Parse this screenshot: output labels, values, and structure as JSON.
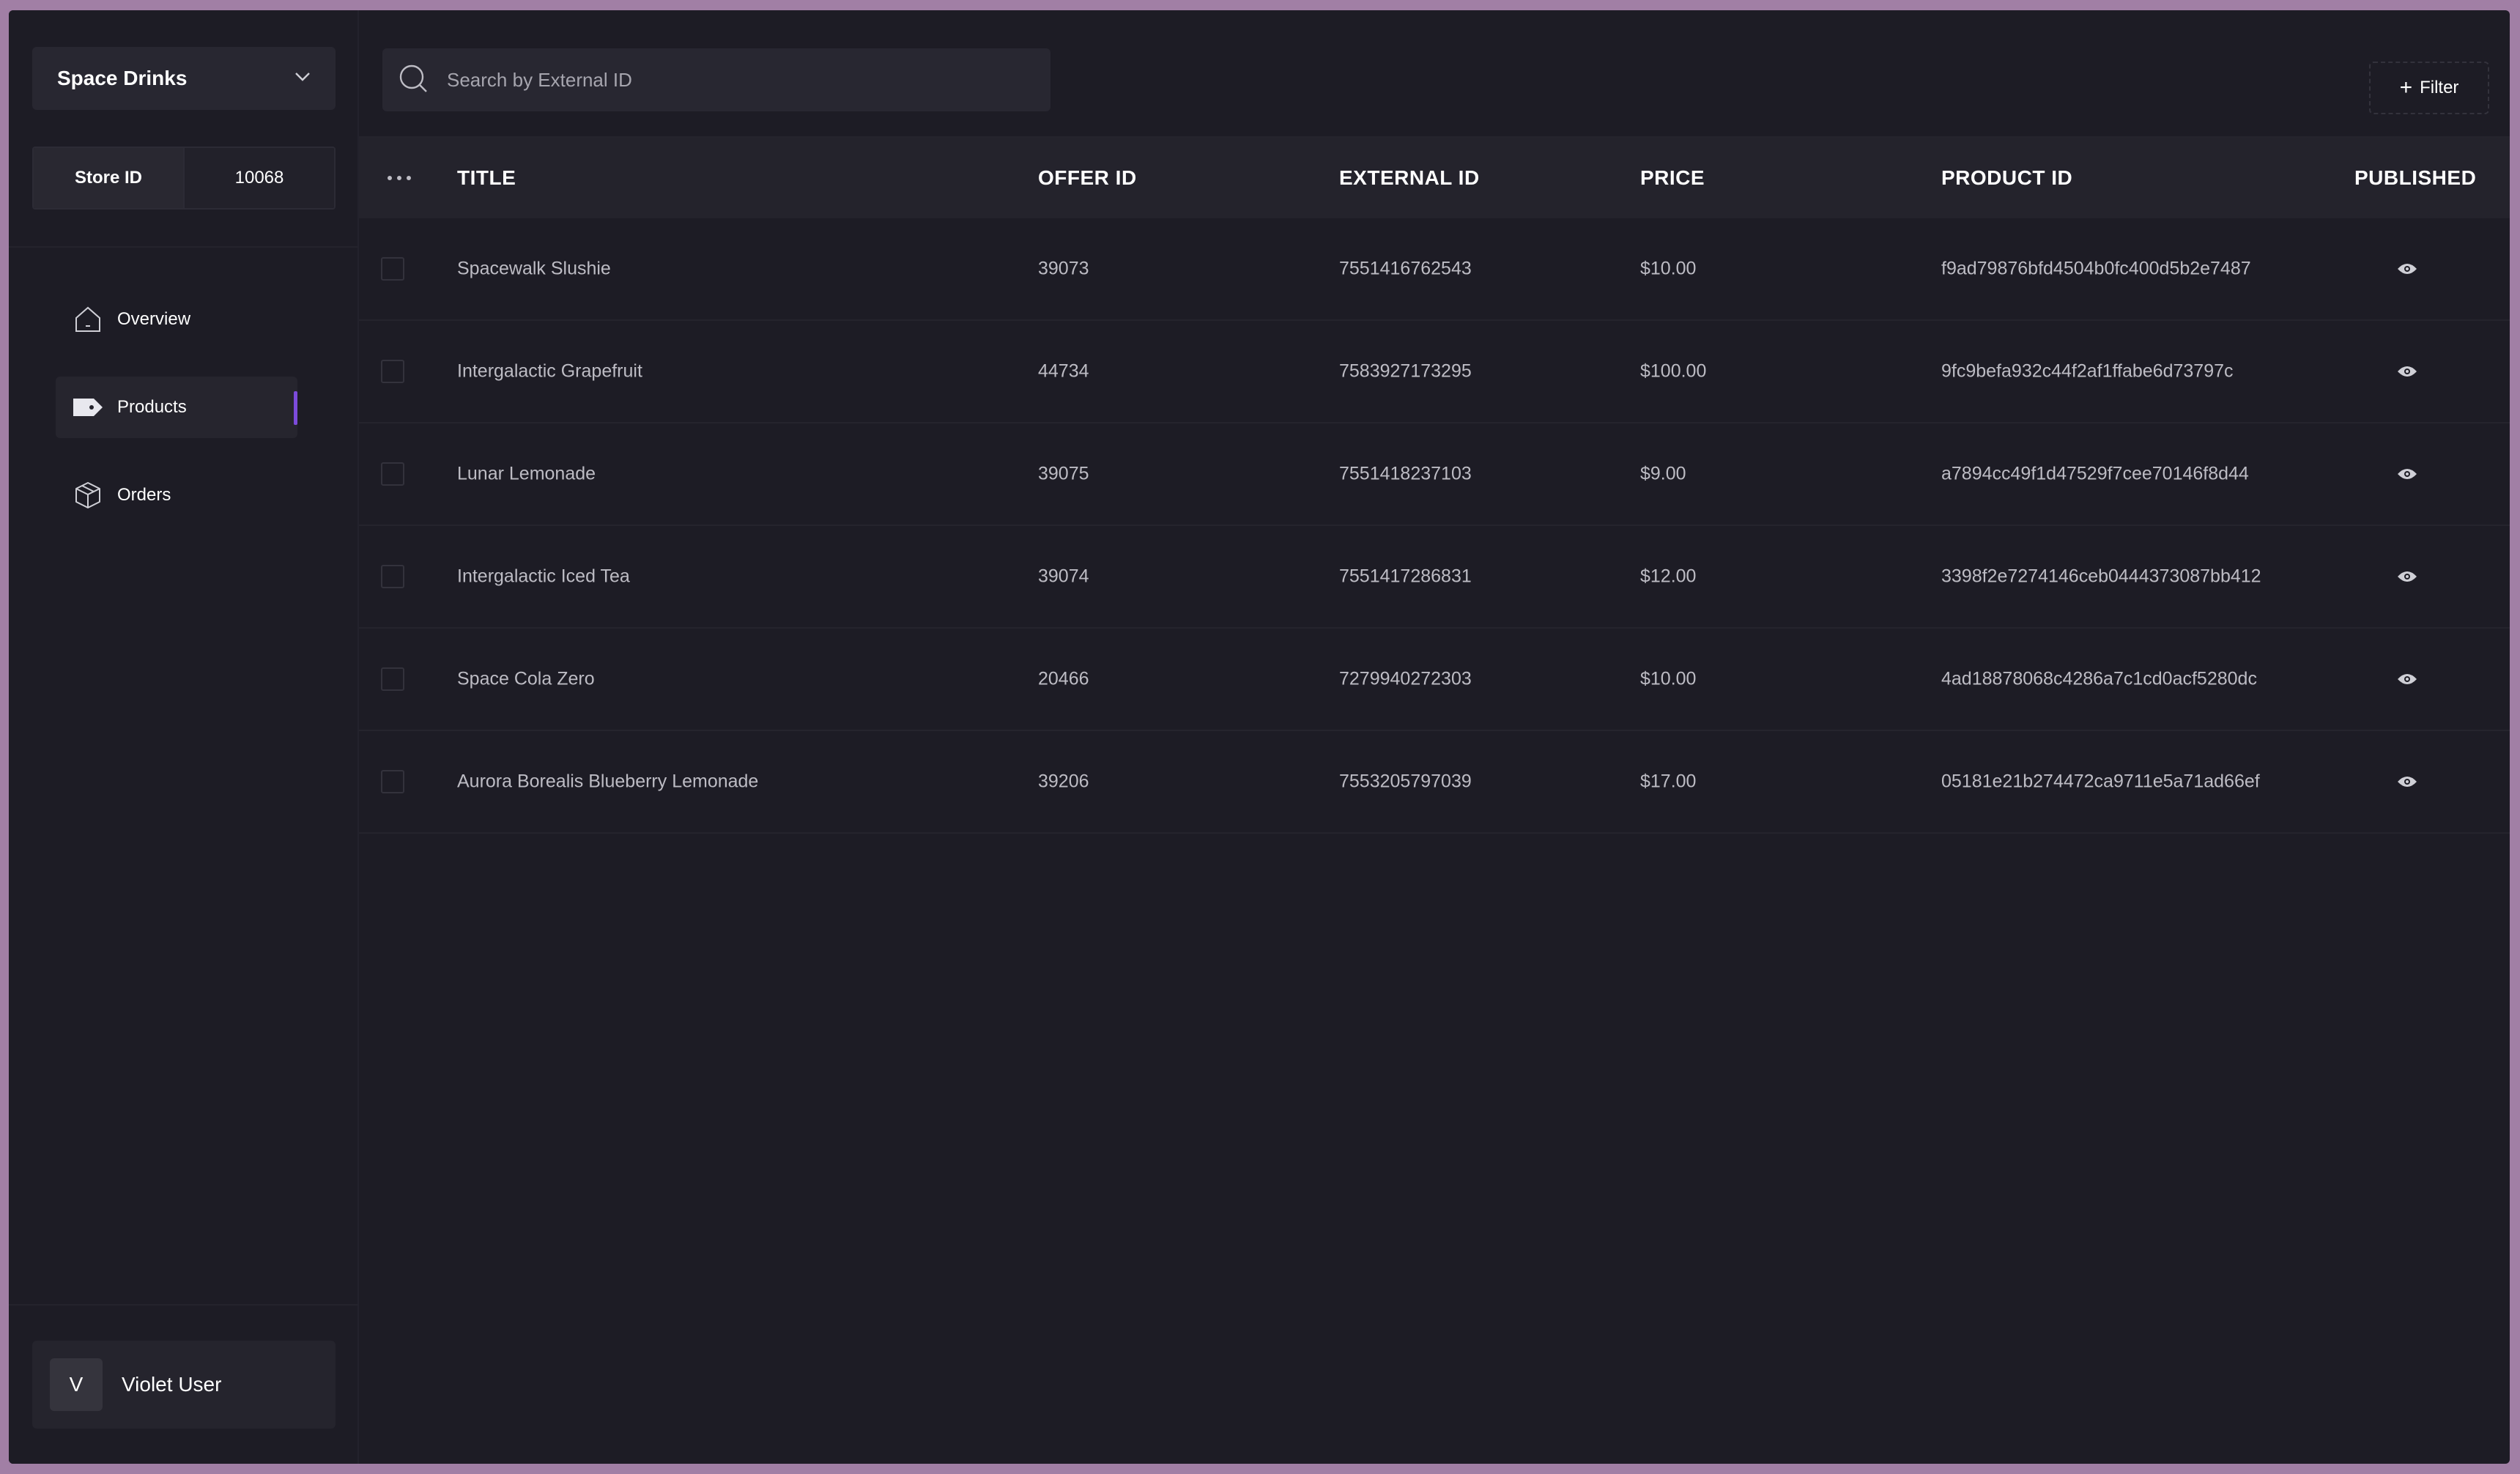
{
  "sidebar": {
    "store_name": "Space Drinks",
    "store_id_label": "Store ID",
    "store_id_value": "10068",
    "nav": [
      {
        "label": "Overview",
        "icon": "home-icon"
      },
      {
        "label": "Products",
        "icon": "tag-icon",
        "active": true
      },
      {
        "label": "Orders",
        "icon": "box-icon"
      }
    ],
    "user": {
      "initial": "V",
      "name": "Violet User"
    }
  },
  "search": {
    "placeholder": "Search by External ID"
  },
  "filter_label": "Filter",
  "table": {
    "headers": {
      "title": "TITLE",
      "offer_id": "OFFER ID",
      "external_id": "EXTERNAL ID",
      "price": "PRICE",
      "product_id": "PRODUCT ID",
      "published": "PUBLISHED"
    },
    "rows": [
      {
        "title": "Spacewalk Slushie",
        "offer_id": "39073",
        "external_id": "7551416762543",
        "price": "$10.00",
        "product_id": "f9ad79876bfd4504b0fc400d5b2e7487"
      },
      {
        "title": "Intergalactic Grapefruit",
        "offer_id": "44734",
        "external_id": "7583927173295",
        "price": "$100.00",
        "product_id": "9fc9befa932c44f2af1ffabe6d73797c"
      },
      {
        "title": "Lunar Lemonade",
        "offer_id": "39075",
        "external_id": "7551418237103",
        "price": "$9.00",
        "product_id": "a7894cc49f1d47529f7cee70146f8d44"
      },
      {
        "title": "Intergalactic Iced Tea",
        "offer_id": "39074",
        "external_id": "7551417286831",
        "price": "$12.00",
        "product_id": "3398f2e7274146ceb0444373087bb412"
      },
      {
        "title": "Space Cola Zero",
        "offer_id": "20466",
        "external_id": "7279940272303",
        "price": "$10.00",
        "product_id": "4ad18878068c4286a7c1cd0acf5280dc"
      },
      {
        "title": "Aurora Borealis Blueberry Lemonade",
        "offer_id": "39206",
        "external_id": "7553205797039",
        "price": "$17.00",
        "product_id": "05181e21b274472ca9711e5a71ad66ef"
      }
    ]
  },
  "colors": {
    "background": "#1d1c25",
    "accent": "#7c4bdb",
    "desktop": "#a17fa5"
  }
}
